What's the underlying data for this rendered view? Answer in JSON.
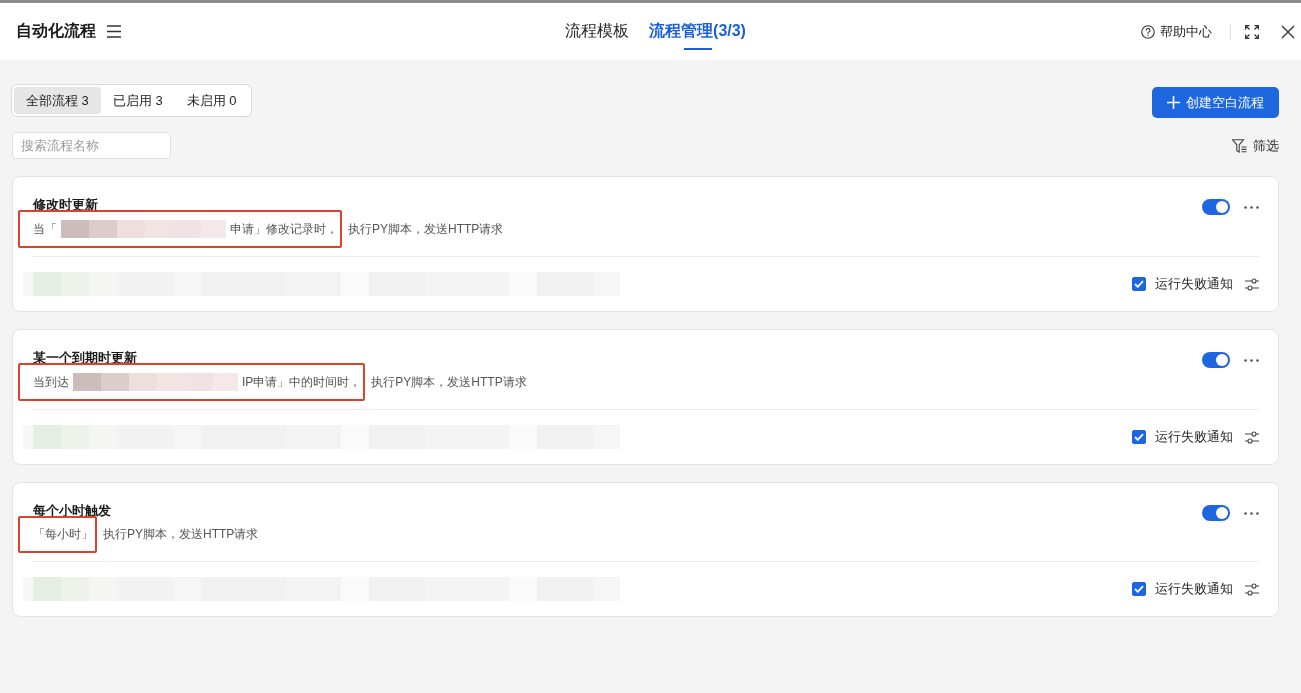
{
  "header": {
    "title": "自动化流程",
    "tabs": [
      {
        "label": "流程模板",
        "selected": false
      },
      {
        "label": "流程管理(3/3)",
        "selected": true
      }
    ],
    "help_label": "帮助中心"
  },
  "toolbar": {
    "filter_tabs": [
      {
        "label": "全部流程 3",
        "selected": true
      },
      {
        "label": "已启用 3",
        "selected": false
      },
      {
        "label": "未启用 0",
        "selected": false
      }
    ],
    "create_button": "创建空白流程",
    "search": {
      "placeholder": "搜索流程名称"
    },
    "filter_label": "筛选"
  },
  "flows": [
    {
      "name": "修改时更新",
      "description": [
        {
          "kind": "text",
          "text": "当「",
          "marked": true
        },
        {
          "kind": "redacted",
          "marked": true
        },
        {
          "kind": "text",
          "text": "申请」修改记录时，",
          "marked": true
        },
        {
          "kind": "text",
          "text": "执行PY脚本，发送HTTP请求",
          "marked": false
        }
      ],
      "enabled": true,
      "notify": {
        "label": "运行失败通知",
        "checked": true
      }
    },
    {
      "name": "某一个到期时更新",
      "description": [
        {
          "kind": "text",
          "text": "当到达",
          "marked": true
        },
        {
          "kind": "redacted",
          "marked": true
        },
        {
          "kind": "text",
          "text": "IP申请」中的时间时，",
          "marked": true
        },
        {
          "kind": "text",
          "text": "执行PY脚本，发送HTTP请求",
          "marked": false
        }
      ],
      "enabled": true,
      "notify": {
        "label": "运行失败通知",
        "checked": true
      }
    },
    {
      "name": "每个小时触发",
      "description": [
        {
          "kind": "text",
          "text": "「每小时」",
          "marked": true
        },
        {
          "kind": "text",
          "text": "执行PY脚本，发送HTTP请求",
          "marked": false
        }
      ],
      "enabled": true,
      "notify": {
        "label": "运行失败通知",
        "checked": true
      }
    }
  ]
}
